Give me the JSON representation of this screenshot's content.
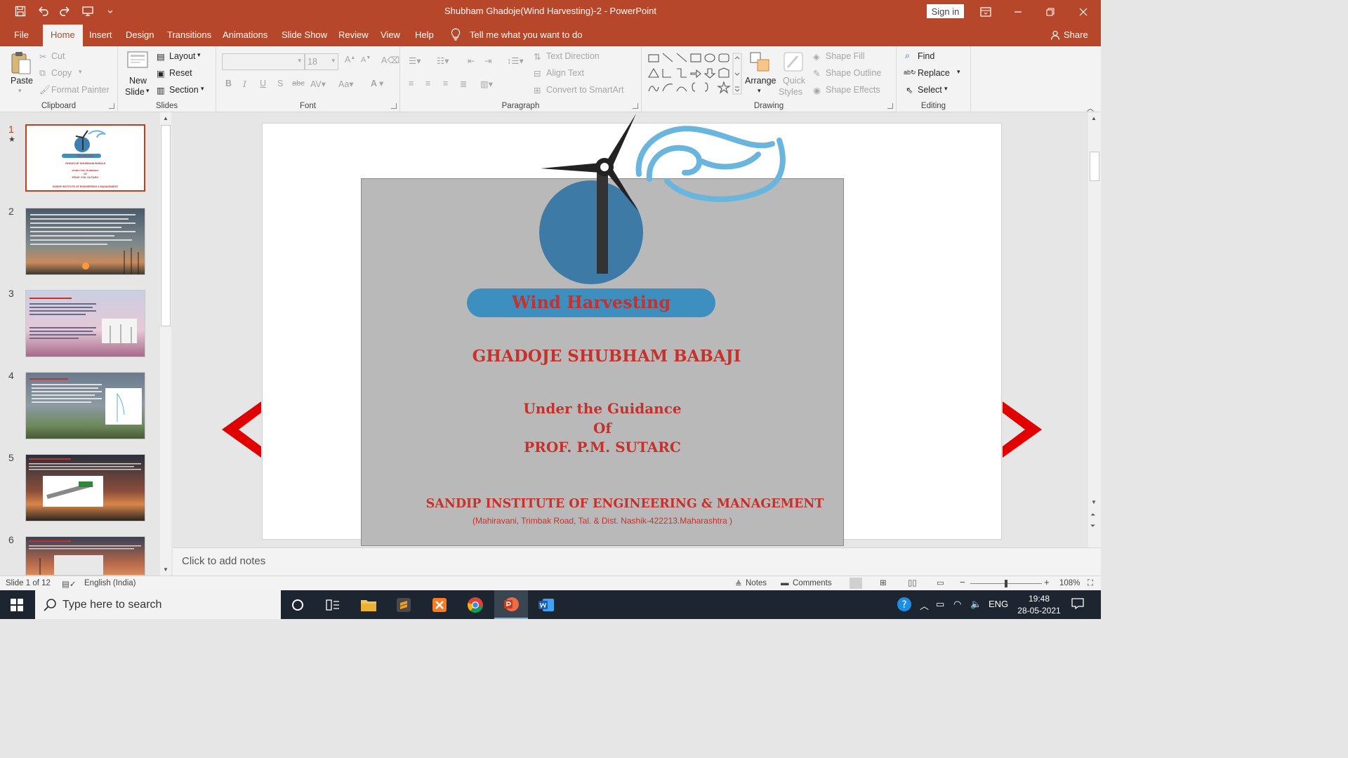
{
  "titlebar": {
    "title": "Shubham Ghadoje(Wind Harvesting)-2  -  PowerPoint",
    "signin": "Sign in"
  },
  "tabs": [
    "File",
    "Home",
    "Insert",
    "Design",
    "Transitions",
    "Animations",
    "Slide Show",
    "Review",
    "View",
    "Help"
  ],
  "tell_me": "Tell me what you want to do",
  "share": "Share",
  "ribbon": {
    "clipboard": {
      "paste": "Paste",
      "cut": "Cut",
      "copy": "Copy",
      "format_painter": "Format Painter",
      "label": "Clipboard"
    },
    "slides": {
      "new_slide_1": "New",
      "new_slide_2": "Slide",
      "layout": "Layout",
      "reset": "Reset",
      "section": "Section",
      "label": "Slides"
    },
    "font": {
      "font_size": "18",
      "label": "Font"
    },
    "paragraph": {
      "text_direction": "Text Direction",
      "align_text": "Align Text",
      "convert_smartart": "Convert to SmartArt",
      "label": "Paragraph"
    },
    "drawing": {
      "arrange": "Arrange",
      "quick_styles_1": "Quick",
      "quick_styles_2": "Styles",
      "shape_fill": "Shape Fill",
      "shape_outline": "Shape Outline",
      "shape_effects": "Shape Effects",
      "label": "Drawing"
    },
    "editing": {
      "find": "Find",
      "replace": "Replace",
      "select": "Select",
      "label": "Editing"
    }
  },
  "thumbnails": [
    {
      "num": "1",
      "title": "Wind Harvesting",
      "name": "GHADOJE SHUBHAM BABAJI",
      "guide": "Under the Guidance",
      "of": "Of",
      "prof": "PROF. P.M. SUTARC",
      "inst": "SANDIP INSTITUTE OF ENGINEERING & MANAGEMENT"
    },
    {
      "num": "2"
    },
    {
      "num": "3"
    },
    {
      "num": "4"
    },
    {
      "num": "5"
    },
    {
      "num": "6"
    }
  ],
  "slide": {
    "title_pill": "Wind Harvesting",
    "name": "GHADOJE SHUBHAM BABAJI",
    "guidance": "Under the Guidance",
    "of": "Of",
    "prof": "PROF. P.M. SUTARC",
    "institute": "SANDIP INSTITUTE OF ENGINEERING & MANAGEMENT",
    "address": "(Mahiravani, Trimbak Road, Tal. & Dist. Nashik-422213.Maharashtra  )",
    "accent": "#c8302b",
    "pill_color": "#3d8fbf"
  },
  "notes_placeholder": "Click to add notes",
  "status": {
    "slide_info": "Slide 1 of 12",
    "language": "English (India)",
    "notes": "Notes",
    "comments": "Comments",
    "zoom": "108%"
  },
  "taskbar": {
    "search_placeholder": "Type here to search",
    "lang": "ENG",
    "time": "19:48",
    "date": "28-05-2021"
  }
}
